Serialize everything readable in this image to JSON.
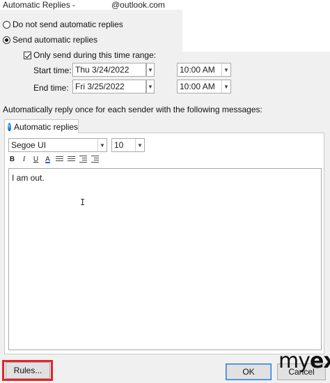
{
  "window": {
    "title": "Automatic Replies - ",
    "account": "@outlook.com"
  },
  "options": {
    "no_reply_label": "Do not send automatic replies",
    "send_reply_label": "Send automatic replies",
    "time_range_label": "Only send during this time range:",
    "send_reply_selected": true,
    "time_range_checked": true
  },
  "schedule": {
    "start_label": "Start time:",
    "start_date": "Thu 3/24/2022",
    "start_time": "10:00 AM",
    "end_label": "End time:",
    "end_date": "Fri 3/25/2022",
    "end_time": "10:00 AM"
  },
  "message": {
    "instructions": "Automatically reply once for each sender with the following messages:",
    "tab_label": "Automatic replies",
    "font_name": "Segoe UI",
    "font_size": "10",
    "body_text": "I am out."
  },
  "toolbar": {
    "bold": "B",
    "italic": "I",
    "underline": "U",
    "font_color": "A"
  },
  "footer": {
    "rules_label": "Rules...",
    "ok_label": "OK",
    "cancel_label": "Cancel",
    "brand_light": "my",
    "brand_bold": "ex"
  },
  "colors": {
    "highlight": "#e0252e",
    "ok_border": "#2b78d6"
  }
}
